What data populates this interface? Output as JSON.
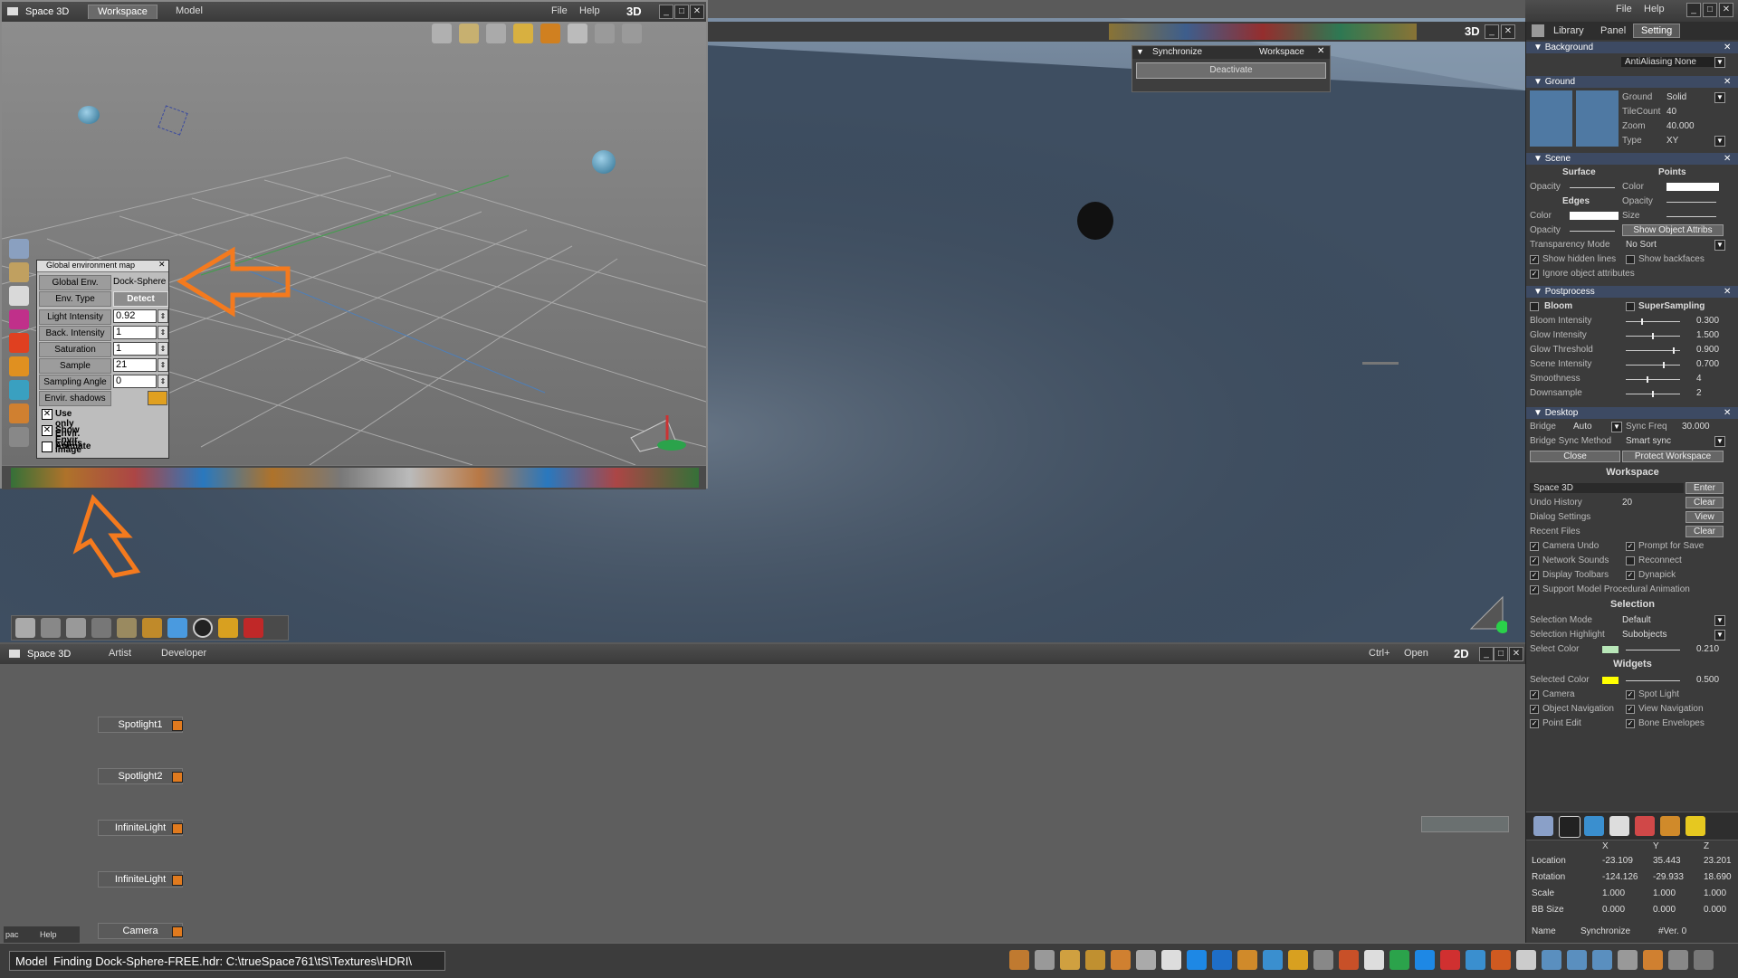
{
  "viewport_main": {
    "title": "3D",
    "icons": [
      "pointer-icon",
      "rotate-icon",
      "move-icon",
      "scale-icon",
      "gear-icon",
      "shapes-icon",
      "x-axis-icon",
      "y-axis-icon",
      "z-axis-icon",
      "object-icon",
      "material-icon",
      "camera-icon"
    ]
  },
  "small_window": {
    "app_name": "Space 3D",
    "tabs": [
      "Workspace",
      "Model"
    ],
    "menu": {
      "file": "File",
      "help": "Help",
      "mode": "3D"
    }
  },
  "env_panel": {
    "title": "Global environment map",
    "rows": [
      {
        "label": "Global Env.",
        "value": "Dock-Sphere"
      },
      {
        "label": "Env. Type",
        "value": "Detect"
      },
      {
        "label": "Light Intensity",
        "value": "0.92"
      },
      {
        "label": "Back. Intensity",
        "value": "1"
      },
      {
        "label": "Saturation",
        "value": "1"
      },
      {
        "label": "Sample",
        "value": "21"
      },
      {
        "label": "Sampling Angle",
        "value": "0"
      },
      {
        "label": "Envir. shadows",
        "value": ""
      }
    ],
    "checks": [
      {
        "label": "Use only Envir. Lights",
        "checked": true
      },
      {
        "label": "Show Envir. Image",
        "checked": true
      },
      {
        "label": "Animate",
        "checked": false
      }
    ]
  },
  "sync_window": {
    "title": "Synchronize",
    "tab": "Workspace",
    "button": "Deactivate"
  },
  "topbar_right": {
    "tabs": [
      "Library",
      "Panel",
      "Setting"
    ],
    "menu": {
      "file": "File",
      "help": "Help"
    }
  },
  "right_panel": {
    "background": {
      "header": "Background",
      "antialias": "AntiAliasing None"
    },
    "ground": {
      "header": "Ground",
      "rows": [
        {
          "label": "Ground",
          "value": "Solid"
        },
        {
          "label": "TileCount",
          "value": "40"
        },
        {
          "label": "Zoom",
          "value": "40.000"
        },
        {
          "label": "Type",
          "value": "XY"
        }
      ]
    },
    "scene": {
      "header": "Scene",
      "surface": "Surface",
      "points": "Points",
      "opacity": "Opacity",
      "color": "Color",
      "edges": "Edges",
      "size": "Size",
      "show_object_attribs": "Show Object Attribs",
      "transparency_mode": "Transparency Mode",
      "transparency_value": "No Sort",
      "show_hidden_lines": "Show hidden lines",
      "show_backfaces": "Show backfaces",
      "ignore_object_attributes": "Ignore object attributes"
    },
    "postprocess": {
      "header": "Postprocess",
      "bloom": "Bloom",
      "supersampling": "SuperSampling",
      "rows": [
        {
          "label": "Bloom Intensity",
          "value": "0.300",
          "level": 0.3
        },
        {
          "label": "Glow Intensity",
          "value": "1.500",
          "level": 0.5
        },
        {
          "label": "Glow Threshold",
          "value": "0.900",
          "level": 0.9
        },
        {
          "label": "Scene Intensity",
          "value": "0.700",
          "level": 0.7
        },
        {
          "label": "Smoothness",
          "value": "4",
          "level": 0.4
        },
        {
          "label": "Downsample",
          "value": "2",
          "level": 0.5
        }
      ]
    },
    "desktop": {
      "header": "Desktop",
      "bridge": "Bridge",
      "bridge_value": "Auto",
      "sync_freq": "Sync Freq",
      "sync_freq_value": "30.000",
      "bridge_sync_method": "Bridge Sync Method",
      "bridge_sync_value": "Smart sync",
      "close": "Close",
      "protect_workspace": "Protect Workspace"
    },
    "workspace": {
      "header": "Workspace",
      "name_value": "Space 3D",
      "enter": "Enter",
      "undo_history": "Undo History",
      "undo_value": "20",
      "clear": "Clear",
      "dialog_settings": "Dialog Settings",
      "view": "View",
      "recent_files": "Recent Files",
      "clear2": "Clear",
      "checks": [
        {
          "label": "Camera Undo",
          "checked": true
        },
        {
          "label": "Prompt for Save",
          "checked": true
        },
        {
          "label": "Network Sounds",
          "checked": true
        },
        {
          "label": "Reconnect",
          "checked": false
        },
        {
          "label": "Display Toolbars",
          "checked": true
        },
        {
          "label": "Dynapick",
          "checked": true
        }
      ],
      "support_model": "Support Model Procedural Animation"
    },
    "selection": {
      "header": "Selection",
      "mode_label": "Selection Mode",
      "mode_value": "Default",
      "highlight_label": "Selection Highlight",
      "highlight_value": "Subobjects",
      "color_label": "Select Color",
      "color_value": "0.210"
    },
    "widgets": {
      "header": "Widgets",
      "selected_color": "Selected Color",
      "selected_value": "0.500",
      "checks": [
        {
          "label": "Camera",
          "checked": true
        },
        {
          "label": "Spot Light",
          "checked": true
        },
        {
          "label": "Object Navigation",
          "checked": true
        },
        {
          "label": "View Navigation",
          "checked": true
        },
        {
          "label": "Point Edit",
          "checked": true
        },
        {
          "label": "Bone Envelopes",
          "checked": true
        }
      ]
    },
    "transform": {
      "headers": [
        "X",
        "Y",
        "Z"
      ],
      "rows": [
        {
          "label": "Location",
          "x": "-23.109",
          "y": "35.443",
          "z": "23.201"
        },
        {
          "label": "Rotation",
          "x": "-124.126",
          "y": "-29.933",
          "z": "18.690"
        },
        {
          "label": "Scale",
          "x": "1.000",
          "y": "1.000",
          "z": "1.000"
        },
        {
          "label": "BB Size",
          "x": "0.000",
          "y": "0.000",
          "z": "0.000"
        }
      ],
      "name_label": "Name",
      "name_value": "Synchronize",
      "ver": "#Ver. 0"
    }
  },
  "link_editor": {
    "app_name": "Space 3D",
    "tabs": [
      "Artist",
      "Developer"
    ],
    "ctrl": "Ctrl+",
    "open": "Open",
    "mode": "2D",
    "nodes": [
      "Spotlight1",
      "Spotlight2",
      "InfiniteLight",
      "InfiniteLight",
      "Camera"
    ],
    "mini_labels": [
      "pac",
      "Help"
    ]
  },
  "status_bar": {
    "mode": "Model",
    "message": "Finding Dock-Sphere-FREE.hdr: C:\\trueSpace761\\tS\\Textures\\HDRI\\"
  },
  "colors": {
    "accent_orange": "#f47a1e",
    "panel_header": "#3d4a63",
    "selected_color": "#ffff00"
  }
}
